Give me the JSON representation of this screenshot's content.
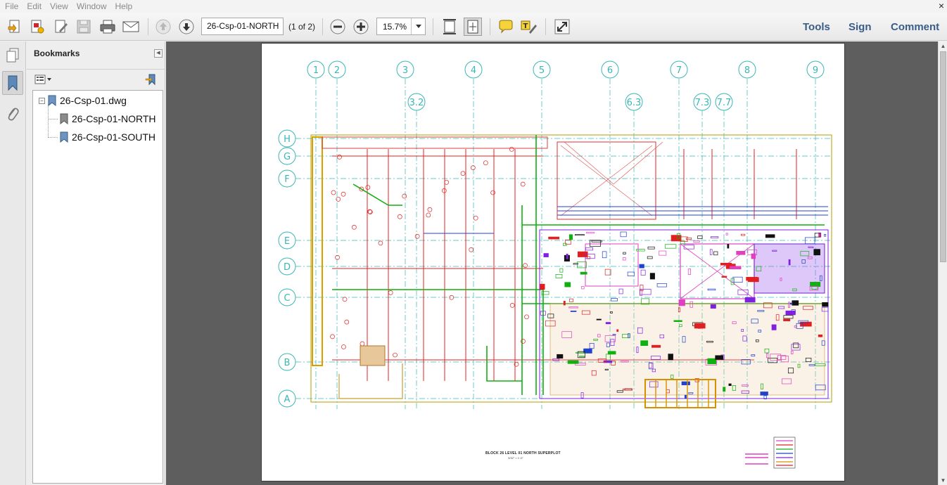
{
  "menu": {
    "items": [
      "File",
      "Edit",
      "View",
      "Window",
      "Help"
    ],
    "close_glyph": "×"
  },
  "toolbar": {
    "page_field": "26-Csp-01-NORTH",
    "page_count": "(1 of 2)",
    "zoom": "15.7%",
    "tools_label": "Tools",
    "sign_label": "Sign",
    "comment_label": "Comment",
    "link_color": "#3a5d87"
  },
  "bookmarks": {
    "title": "Bookmarks",
    "root": "26-Csp-01.dwg",
    "children": [
      "26-Csp-01-NORTH",
      "26-Csp-01-SOUTH"
    ]
  },
  "drawing": {
    "grid_columns": [
      "1",
      "2",
      "3",
      "4",
      "5",
      "6",
      "7",
      "8",
      "9"
    ],
    "grid_sub_columns": [
      "3.2",
      "6.3",
      "7.3",
      "7.7"
    ],
    "grid_rows": [
      "H",
      "G",
      "F",
      "E",
      "D",
      "C",
      "B",
      "A"
    ],
    "title_text": "BLOCK 26 LEVEL 01 NORTH SUPERPLOT",
    "scale_text": "3/32\" = 1'-0\"",
    "grid_color": "#3bb6b6"
  }
}
